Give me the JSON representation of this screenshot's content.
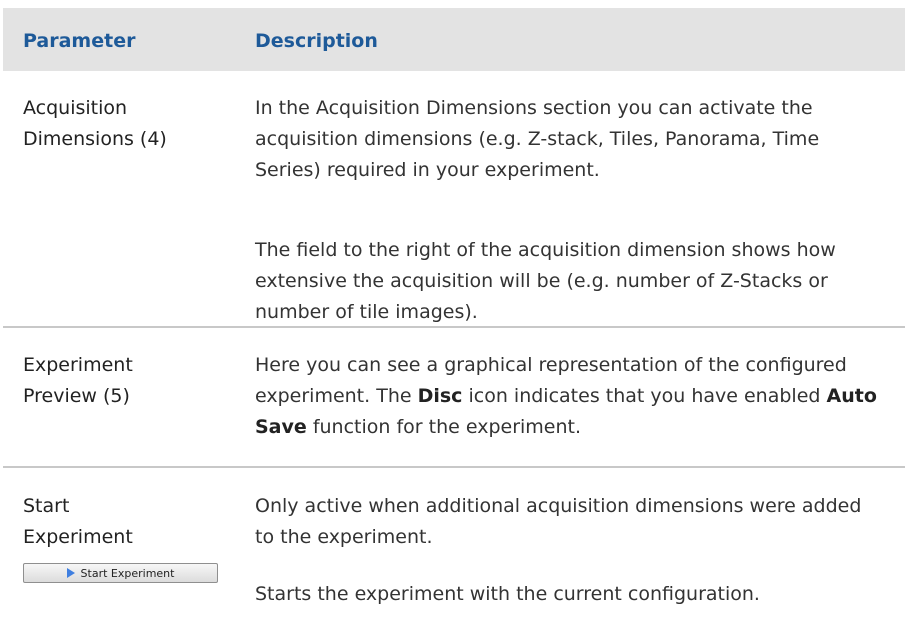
{
  "header": {
    "parameter": "Parameter",
    "description": "Description"
  },
  "rows": [
    {
      "param_line1": "Acquisition",
      "param_line2": "Dimensions (4)",
      "paragraphs": [
        "In the Acquisition Dimensions section you can activate the acquisition dimensions (e.g. Z-stack, Tiles, Panorama, Time Series) required in your experiment.",
        "The field to the right of the acquisition dimension shows how extensive the acquisition will be (e.g. number of Z-Stacks or number of tile images)."
      ]
    },
    {
      "param_line1": "Experiment",
      "param_line2": "Preview (5)",
      "seg1": "Here you can see a graphical representation of the configured experiment. The ",
      "bold1": "Disc",
      "seg2": " icon indicates that you have enabled ",
      "bold2": "Auto Save",
      "seg3": " function for the experiment."
    },
    {
      "param_line1": "Start",
      "param_line2": "Experiment",
      "button_label": "Start Experiment",
      "button_icon": "play-icon",
      "paragraphs": [
        "Only active when additional acquisition dimensions were added to the experiment.",
        "Starts the experiment with the current configuration."
      ]
    }
  ],
  "colors": {
    "header_bg": "#e3e3e3",
    "header_text": "#1e5a99",
    "play_icon": "#3f7fe0"
  }
}
